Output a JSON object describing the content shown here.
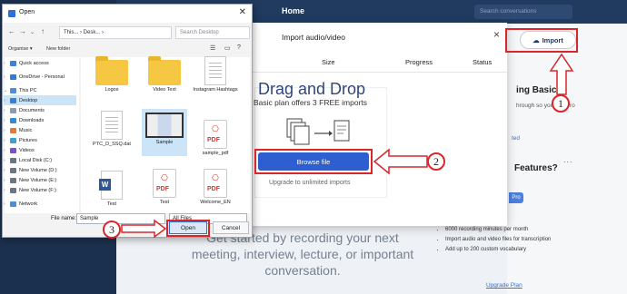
{
  "bg_app": {
    "nav_title": "Home",
    "search_placeholder": "Search conversations",
    "import_button": "Import",
    "headline": "Get started by recording your next meeting, interview, lecture, or important conversation.",
    "panel_heading1": "ing Basics",
    "panel_text1": "hrough so you can pro",
    "panel_link1": "ted",
    "panel_heading2": "Features?",
    "panel_menu": "...",
    "pro_label": "Pro",
    "bullets": [
      "6000 recording minutes per month",
      "Import audio and video files for transcription",
      "Add up to 200 custom vocabulary"
    ],
    "upgrade_link": "Upgrade Plan"
  },
  "import_modal": {
    "title": "Import audio/video",
    "close": "×",
    "columns": [
      "Size",
      "Progress",
      "Status"
    ],
    "drop_title": "Drag and Drop",
    "drop_subtitle": "Basic plan offers 3 FREE imports",
    "browse_button": "Browse file",
    "upgrade_text": "Upgrade to unlimited imports"
  },
  "open_dialog": {
    "title": "Open",
    "close": "✕",
    "address": "This... › Desk... ›",
    "search_placeholder": "Search Desktop",
    "toolbar": {
      "organise": "Organise ▾",
      "new_folder": "New folder"
    },
    "nav_items": [
      "Quick access",
      "OneDrive - Personal",
      "This PC",
      "Desktop",
      "Documents",
      "Downloads",
      "Music",
      "Pictures",
      "Videos",
      "Local Disk (C:)",
      "New Volume (D:)",
      "New Volume (E:)",
      "New Volume (F:)",
      "Network"
    ],
    "files": [
      {
        "name": "Logos",
        "kind": "folder"
      },
      {
        "name": "Video Text",
        "kind": "folder"
      },
      {
        "name": "Instagram Hashtags",
        "kind": "doc"
      },
      {
        "name": "PTC_D_SSQ.dat",
        "kind": "doc"
      },
      {
        "name": "Sample",
        "kind": "video"
      },
      {
        "name": "sample_pdf",
        "kind": "pdf"
      },
      {
        "name": "Test",
        "kind": "word"
      },
      {
        "name": "Test",
        "kind": "pdf"
      },
      {
        "name": "Welcome_EN",
        "kind": "pdf"
      }
    ],
    "file_name_label": "File name:",
    "file_name_value": "Sample",
    "file_type": "All Files",
    "open_button": "Open",
    "cancel_button": "Cancel"
  },
  "annotations": {
    "step1": "1",
    "step2": "2",
    "step3": "3"
  },
  "colors": {
    "annotation": "#d9262b",
    "brand": "#203a60",
    "browse": "#2d5fd0"
  }
}
